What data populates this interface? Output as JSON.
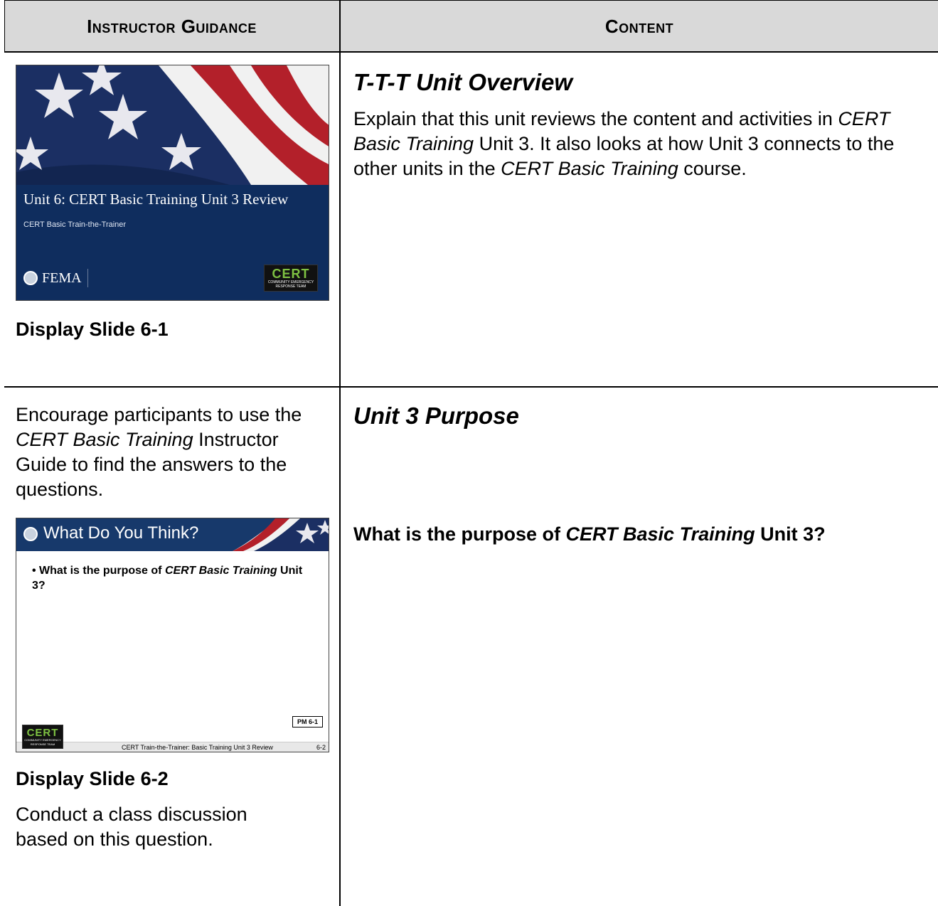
{
  "header": {
    "left": "Instructor Guidance",
    "right": "Content"
  },
  "row1": {
    "slide": {
      "title": "Unit 6: CERT Basic Training Unit 3 Review",
      "subtitle": "CERT Basic Train-the-Trainer",
      "agency": "FEMA",
      "logo_word": "CERT",
      "logo_tagline": "COMMUNITY EMERGENCY RESPONSE TEAM"
    },
    "caption": "Display Slide 6-1",
    "content_title": "T-T-T Unit Overview",
    "paragraph": {
      "p1": "Explain that this unit reviews the content and activities in",
      "p2": "CERT Basic Training",
      "p3": " Unit 3.  It also looks at how Unit 3 connects to the other units in the ",
      "p4": "CERT Basic Training",
      "p5": " course."
    }
  },
  "row2": {
    "intro": {
      "p1": "Encourage participants to use the ",
      "p2": "CERT Basic Training",
      "p3": " Instructor Guide to find the answers to the questions."
    },
    "slide": {
      "title": "What Do You Think?",
      "bullet_a": "What is the purpose of ",
      "bullet_b": "CERT Basic Training",
      "bullet_c": " Unit 3?",
      "pm_tag": "PM 6-1",
      "footer": "CERT Train-the-Trainer: Basic Training Unit 3 Review",
      "page": "6-2",
      "logo_word": "CERT",
      "logo_tagline": "COMMUNITY EMERGENCY RESPONSE TEAM"
    },
    "caption": "Display Slide 6-2",
    "instruction": "Conduct a class discussion based on this question.",
    "content_title": "Unit 3 Purpose",
    "question": {
      "q1": "What is the purpose of ",
      "q2": "CERT Basic Training",
      "q3": " Unit 3?"
    }
  },
  "colors": {
    "header_bg": "#d9d9d9",
    "slide_navy": "#0f2d5e",
    "flag_red": "#b3202a",
    "cert_green": "#7ec242"
  }
}
